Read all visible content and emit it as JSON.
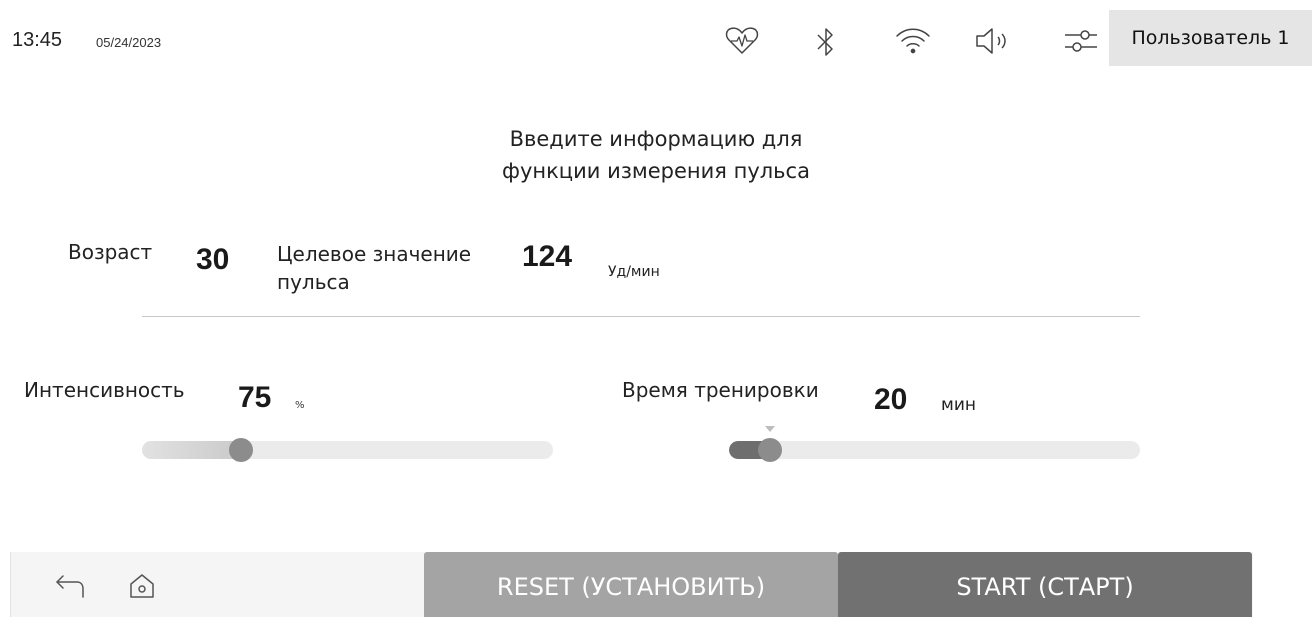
{
  "status_bar": {
    "time": "13:45",
    "date": "05/24/2023",
    "icons": [
      "heart-rate-icon",
      "bluetooth-icon",
      "wifi-icon",
      "volume-icon",
      "settings-sliders-icon"
    ],
    "user_label": "Пользователь 1"
  },
  "heading": {
    "line1": "Введите информацию для",
    "line2": "функции измерения пульса"
  },
  "profile": {
    "age_label": "Возраст",
    "age_value": "30",
    "target_label_line1": "Целевое значение",
    "target_label_line2": "пульса",
    "target_value": "124",
    "target_unit": "Уд/мин"
  },
  "intensity": {
    "label": "Интенсивность",
    "value": "75",
    "unit": "%",
    "slider_level": 0.24
  },
  "workout_time": {
    "label": "Время тренировки",
    "value": "20",
    "unit": "мин",
    "slider_level": 0.1
  },
  "footer": {
    "icons": [
      "back-arrow-icon",
      "home-icon"
    ],
    "reset_label": "RESET (УСТАНОВИТЬ)",
    "start_label": "START (СТАРТ)"
  },
  "colors": {
    "button_reset": "#a4a4a4",
    "button_start": "#717171",
    "slider_track": "#ebebeb",
    "slider_knob": "#8c8c8c"
  }
}
